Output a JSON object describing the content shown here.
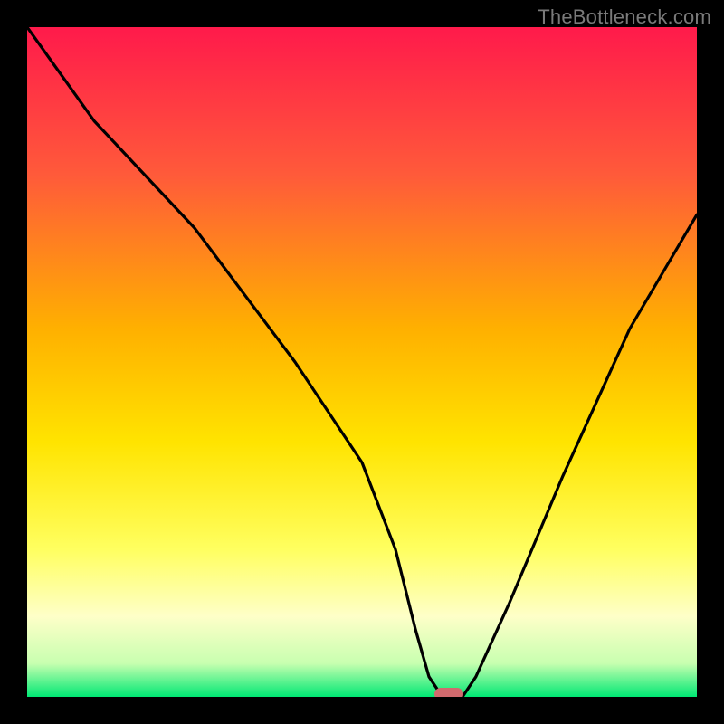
{
  "watermark": "TheBottleneck.com",
  "colors": {
    "bg": "#000000",
    "gradient_top": "#ff1a4b",
    "gradient_mid_upper": "#ff7a2e",
    "gradient_mid": "#ffd000",
    "gradient_lower": "#ffff80",
    "gradient_pale": "#fdffd8",
    "gradient_bottom": "#00e874",
    "curve": "#000000",
    "marker": "#d16a6e",
    "watermark": "#7a7a7a"
  },
  "chart_data": {
    "type": "line",
    "title": "",
    "xlabel": "",
    "ylabel": "",
    "xlim": [
      0,
      100
    ],
    "ylim": [
      0,
      100
    ],
    "series": [
      {
        "name": "bottleneck-curve",
        "x": [
          0,
          10,
          25,
          40,
          50,
          55,
          58,
          60,
          62,
          65,
          67,
          72,
          80,
          90,
          100
        ],
        "values": [
          100,
          86,
          70,
          50,
          35,
          22,
          10,
          3,
          0,
          0,
          3,
          14,
          33,
          55,
          72
        ]
      }
    ],
    "annotations": [
      {
        "name": "optimal-marker",
        "x": 63,
        "y": 0
      }
    ],
    "grid": false,
    "legend": false
  }
}
